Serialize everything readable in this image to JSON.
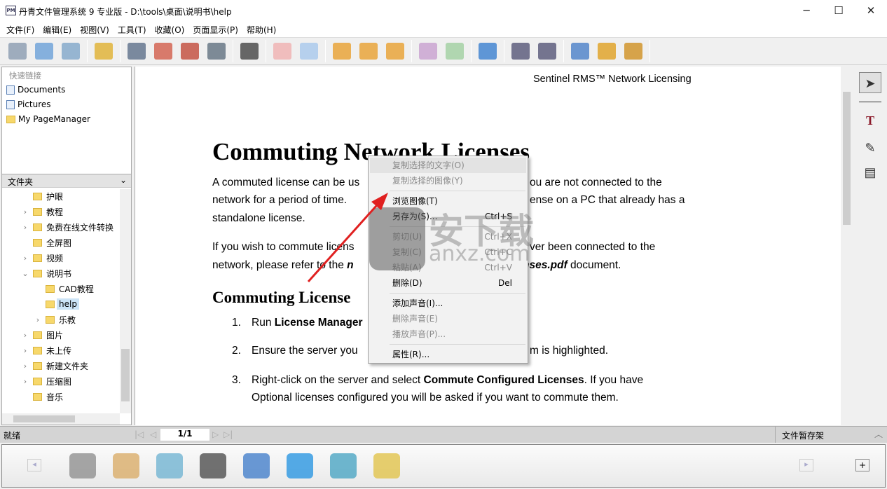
{
  "window": {
    "title": "丹青文件管理系统 9 专业版 - D:\\tools\\桌面\\说明书\\help",
    "icon_text": "PM",
    "min": "─",
    "max": "☐",
    "close": "✕"
  },
  "menu": [
    "文件(F)",
    "编辑(E)",
    "视图(V)",
    "工具(T)",
    "收藏(O)",
    "页面显示(P)",
    "帮助(H)"
  ],
  "toolbar": {
    "groups": [
      [
        {
          "icon": "scanner-icon",
          "color": "#8a9bb0"
        },
        {
          "icon": "import-icon",
          "color": "#6aa0d8"
        },
        {
          "icon": "batch-settings-icon",
          "color": "#7fa6c9"
        }
      ],
      [
        {
          "icon": "lightning-icon",
          "color": "#e0b030"
        }
      ],
      [
        {
          "icon": "save-icon",
          "color": "#5c6f8a"
        },
        {
          "icon": "export-pdf-icon",
          "color": "#d25c4a"
        },
        {
          "icon": "export-xps-icon",
          "color": "#c24a3a"
        },
        {
          "icon": "convert-icon",
          "color": "#607080"
        }
      ],
      [
        {
          "icon": "binoculars-icon",
          "color": "#444"
        }
      ],
      [
        {
          "icon": "move-left-icon",
          "color": "#f0b0b0"
        },
        {
          "icon": "move-right-icon",
          "color": "#a8c8ec"
        }
      ],
      [
        {
          "icon": "thumbnail-view-icon",
          "color": "#e8a030"
        },
        {
          "icon": "page-view-icon",
          "color": "#e8a030"
        },
        {
          "icon": "list-view-icon",
          "color": "#e8a030"
        }
      ],
      [
        {
          "icon": "window-view-icon",
          "color": "#c8a0d0"
        },
        {
          "icon": "ocr-icon",
          "color": "#a0d0a0"
        }
      ],
      [
        {
          "icon": "browser-icon",
          "color": "#3a7fd0"
        }
      ],
      [
        {
          "icon": "zoom-out-icon",
          "color": "#557"
        },
        {
          "icon": "zoom-in-icon",
          "color": "#557"
        }
      ],
      [
        {
          "icon": "settings-icon",
          "color": "#4a80c8"
        },
        {
          "icon": "network-icon",
          "color": "#e0a020"
        },
        {
          "icon": "satellite-icon",
          "color": "#d09020"
        }
      ]
    ]
  },
  "left": {
    "quick_title": "快速链接",
    "quick_links": [
      {
        "label": "Documents",
        "icon": "documents-icon"
      },
      {
        "label": "Pictures",
        "icon": "pictures-icon"
      },
      {
        "label": "My PageManager",
        "icon": "folder-icon"
      }
    ],
    "folder_header": "文件夹",
    "tree": [
      {
        "label": "护眼",
        "level": 0,
        "expander": ""
      },
      {
        "label": "教程",
        "level": 0,
        "expander": ">"
      },
      {
        "label": "免费在线文件转换",
        "level": 0,
        "expander": ">"
      },
      {
        "label": "全屏图",
        "level": 0,
        "expander": ""
      },
      {
        "label": "视频",
        "level": 0,
        "expander": ">"
      },
      {
        "label": "说明书",
        "level": 0,
        "expander": "v"
      },
      {
        "label": "CAD教程",
        "level": 1,
        "expander": ""
      },
      {
        "label": "help",
        "level": 1,
        "expander": "",
        "selected": true
      },
      {
        "label": "乐教",
        "level": 1,
        "expander": ">"
      },
      {
        "label": "图片",
        "level": 0,
        "expander": ">"
      },
      {
        "label": "未上传",
        "level": 0,
        "expander": ">"
      },
      {
        "label": "新建文件夹",
        "level": 0,
        "expander": ">"
      },
      {
        "label": "压缩图",
        "level": 0,
        "expander": ">"
      },
      {
        "label": "音乐",
        "level": 0,
        "expander": ""
      }
    ]
  },
  "document": {
    "header": "Sentinel RMS™ Network Licensing",
    "h1": "Commuting Network Licenses",
    "p1a": "A commuted license can be us",
    "p1b": "ou are not connected to the",
    "p1c": "network for a period of time.",
    "p1d": "ense on a PC that already has a",
    "p1e": "standalone license.",
    "p2a": "If you wish to commute licens",
    "p2b": "ver been connected to the",
    "p2c": "network, please refer to the ",
    "p2c_i": "n",
    "p2d_i": "nses.pdf",
    "p2d": " document.",
    "h2": "Commuting License",
    "l1n": "1.",
    "l1": "Run ",
    "l1b": "License Manager",
    ".": ".",
    "l2n": "2.",
    "l2": "Ensure the server you",
    "l2b": "m is highlighted.",
    "l3n": "3.",
    "l3": "Right-click on the server and select ",
    "l3b": "Commute Configured Licenses",
    "l3c": ".  If you have",
    "l3d": "Optional licenses configured you will be asked if you want to commute them."
  },
  "context_menu": [
    {
      "label": "复制选择的文字(O)",
      "disabled": true,
      "highlight": true
    },
    {
      "label": "复制选择的图像(Y)",
      "disabled": true
    },
    {
      "sep": true
    },
    {
      "label": "浏览图像(T)"
    },
    {
      "label": "另存为(S)...",
      "shortcut": "Ctrl+S"
    },
    {
      "sep": true
    },
    {
      "label": "剪切(U)",
      "shortcut": "Ctrl+X",
      "disabled": true
    },
    {
      "label": "复制(C)",
      "shortcut": "Ctrl+C",
      "disabled": true
    },
    {
      "label": "粘贴(A)",
      "shortcut": "Ctrl+V",
      "disabled": true
    },
    {
      "label": "删除(D)",
      "shortcut": "Del"
    },
    {
      "sep": true
    },
    {
      "label": "添加声音(I)..."
    },
    {
      "label": "删除声音(E)",
      "disabled": true
    },
    {
      "label": "播放声音(P)...",
      "disabled": true
    },
    {
      "sep": true
    },
    {
      "label": "属性(R)..."
    }
  ],
  "watermark": {
    "text": "安下载",
    "sub": "anxz.com"
  },
  "status": {
    "left": "就绪",
    "page": "1/1",
    "right": "文件暂存架",
    "first": "|◁",
    "prev": "◁",
    "next": "▷",
    "last": "▷|"
  },
  "right_tools": [
    {
      "icon": "pointer-icon",
      "glyph": "➤"
    },
    {
      "icon": "text-tool-icon",
      "glyph": "T"
    },
    {
      "icon": "highlighter-icon",
      "glyph": "✎"
    },
    {
      "icon": "stamp-icon",
      "glyph": "▤"
    }
  ],
  "dock": {
    "items": [
      {
        "icon": "fax-printer-icon",
        "color": "#8a8a8a"
      },
      {
        "icon": "paint-palette-icon",
        "color": "#d8a860"
      },
      {
        "icon": "notepad-icon",
        "color": "#6ab0d0"
      },
      {
        "icon": "printer-icon",
        "color": "#444"
      },
      {
        "icon": "wordpad-icon",
        "color": "#3a78c8"
      },
      {
        "icon": "internet-explorer-icon",
        "color": "#1e90e0"
      },
      {
        "icon": "remote-desktop-icon",
        "color": "#40a0c0"
      },
      {
        "icon": "photo-editor-icon",
        "color": "#e0c040"
      }
    ],
    "left": "◂",
    "right": "▸",
    "add": "+"
  }
}
